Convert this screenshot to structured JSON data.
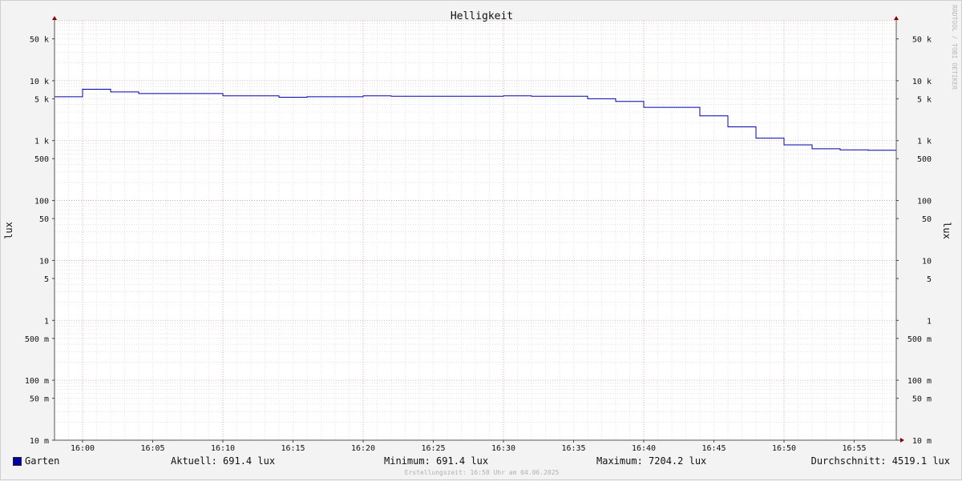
{
  "chart_data": {
    "type": "line",
    "title": "Helligkeit",
    "ylabel": "lux",
    "y_scale": "log",
    "ylim": [
      0.01,
      100000
    ],
    "xlim": [
      "15:58",
      "15:58 (+1h)"
    ],
    "x_ticks": [
      "16:00",
      "16:05",
      "16:10",
      "16:15",
      "16:20",
      "16:25",
      "16:30",
      "16:35",
      "16:40",
      "16:45",
      "16:50",
      "16:55"
    ],
    "y_ticks": [
      {
        "value": 50000,
        "label": "50 k"
      },
      {
        "value": 10000,
        "label": "10 k"
      },
      {
        "value": 5000,
        "label": "5 k"
      },
      {
        "value": 1000,
        "label": "1 k"
      },
      {
        "value": 500,
        "label": "500"
      },
      {
        "value": 100,
        "label": "100"
      },
      {
        "value": 50,
        "label": "50"
      },
      {
        "value": 10,
        "label": "10"
      },
      {
        "value": 5,
        "label": "5"
      },
      {
        "value": 1,
        "label": "1"
      },
      {
        "value": 0.5,
        "label": "500 m"
      },
      {
        "value": 0.1,
        "label": "100 m"
      },
      {
        "value": 0.05,
        "label": "50 m"
      },
      {
        "value": 0.01,
        "label": "10 m"
      }
    ],
    "grid": true,
    "series": [
      {
        "name": "Garten",
        "color": "#0000aa",
        "step": true,
        "x": [
          "15:58",
          "16:00",
          "16:02",
          "16:04",
          "16:06",
          "16:08",
          "16:10",
          "16:12",
          "16:14",
          "16:16",
          "16:18",
          "16:20",
          "16:22",
          "16:24",
          "16:26",
          "16:28",
          "16:30",
          "16:32",
          "16:34",
          "16:36",
          "16:38",
          "16:40",
          "16:42",
          "16:44",
          "16:46",
          "16:48",
          "16:50",
          "16:52",
          "16:54",
          "16:56"
        ],
        "values": [
          5400,
          7204.2,
          6500,
          6100,
          6100,
          6100,
          5600,
          5600,
          5300,
          5400,
          5400,
          5600,
          5500,
          5500,
          5500,
          5500,
          5600,
          5500,
          5500,
          5000,
          4500,
          3600,
          3600,
          2600,
          1700,
          1100,
          850,
          730,
          700,
          691.4
        ]
      }
    ]
  },
  "legend": {
    "series_name": "Garten",
    "current": "Aktuell: 691.4 lux",
    "minimum": "Minimum: 691.4 lux",
    "maximum": "Maximum: 7204.2 lux",
    "average": "Durchschnitt: 4519.1 lux"
  },
  "watermark": "RRDTOOL / TOBI OETIKER",
  "footer": "Erstellungszeit: 16:58 Uhr am 04.06.2025"
}
